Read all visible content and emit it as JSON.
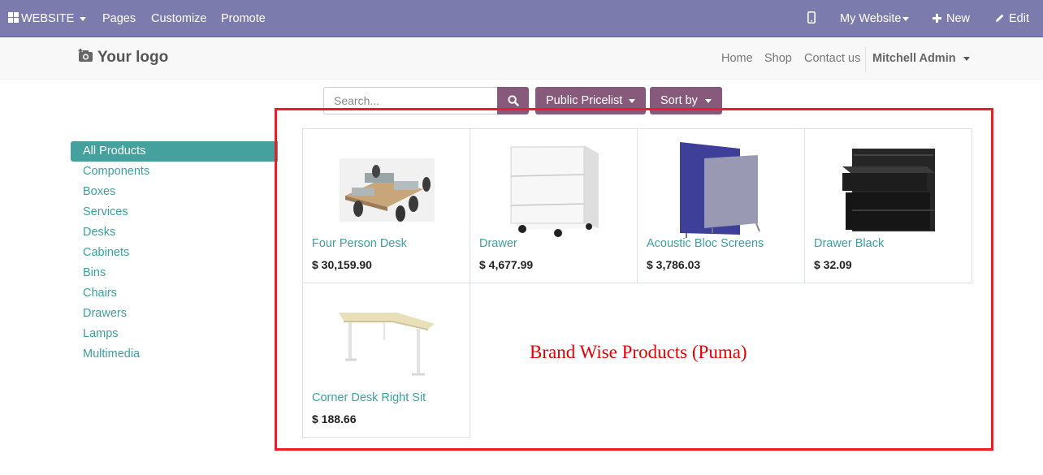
{
  "topbar": {
    "website_label": "WEBSITE",
    "pages": "Pages",
    "customize": "Customize",
    "promote": "Promote",
    "my_website": "My Website",
    "new": "New",
    "edit": "Edit"
  },
  "header": {
    "logo": "Your logo",
    "nav": [
      "Home",
      "Shop",
      "Contact us"
    ],
    "user": "Mitchell Admin"
  },
  "filters": {
    "search_placeholder": "Search...",
    "pricelist": "Public Pricelist",
    "sort": "Sort by"
  },
  "categories": [
    "All Products",
    "Components",
    "Boxes",
    "Services",
    "Desks",
    "Cabinets",
    "Bins",
    "Chairs",
    "Drawers",
    "Lamps",
    "Multimedia"
  ],
  "products": [
    {
      "name": "Four Person Desk",
      "price": "$ 30,159.90"
    },
    {
      "name": "Drawer",
      "price": "$ 4,677.99"
    },
    {
      "name": "Acoustic Bloc Screens",
      "price": "$ 3,786.03"
    },
    {
      "name": "Drawer Black",
      "price": "$ 32.09"
    },
    {
      "name": "Corner Desk Right Sit",
      "price": "$ 188.66"
    }
  ],
  "annotation": "Brand Wise Products (Puma)",
  "colors": {
    "admin_bar": "#7c7bad",
    "primary": "#875a7b",
    "link": "#3c9f9f",
    "active_category": "#44a19e",
    "annotation": "#ee1c24"
  }
}
